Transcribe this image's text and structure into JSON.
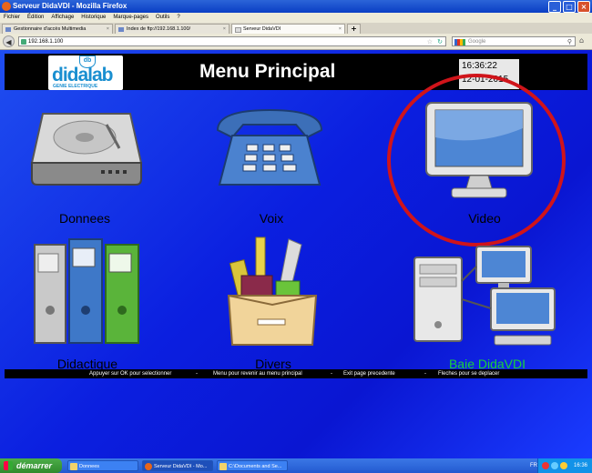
{
  "browser": {
    "window_title": "Serveur DidaVDI - Mozilla Firefox",
    "menu": [
      "Fichier",
      "Édition",
      "Affichage",
      "Historique",
      "Marque-pages",
      "Outils",
      "?"
    ],
    "tabs": [
      {
        "label": "Gestionnaire d'accès Multimedia"
      },
      {
        "label": "Index de ftp://192.168.1.100/"
      },
      {
        "label": "Serveur DidaVDI"
      }
    ],
    "new_tab_label": "+",
    "url": "192.168.1.100",
    "search_placeholder": "Google"
  },
  "page": {
    "logo_text": "didalab",
    "logo_sub": "GENIE ELECTRIQUE",
    "logo_mark": "db",
    "title": "Menu Principal",
    "clock_time": "16:36:22",
    "clock_date": "12-01-2015",
    "menu_items": [
      {
        "label": "Donnees",
        "icon": "hard-drive-icon"
      },
      {
        "label": "Voix",
        "icon": "telephone-icon"
      },
      {
        "label": "Video",
        "icon": "monitor-icon"
      },
      {
        "label": "Didactique",
        "icon": "binders-icon"
      },
      {
        "label": "Divers",
        "icon": "supplies-box-icon"
      },
      {
        "label": "Baie DidaVDI",
        "icon": "network-computers-icon"
      }
    ],
    "hints": [
      "Appuyer sur OK pour selectionner",
      "-",
      "Menu pour revenir au menu principal",
      "-",
      "Exit page precedente",
      "-",
      "Fleches pour se deplacer"
    ],
    "colors": {
      "highlight_label": "#19d23a",
      "selection_circle": "#d0141a",
      "page_blue": "#0b1fe0"
    }
  },
  "taskbar": {
    "start_label": "démarrer",
    "buttons": [
      {
        "label": "Donnees"
      },
      {
        "label": "Serveur DidaVDI - Mo..."
      },
      {
        "label": "C:\\Documents and Se..."
      }
    ],
    "language": "FR",
    "clock": "16:36"
  }
}
